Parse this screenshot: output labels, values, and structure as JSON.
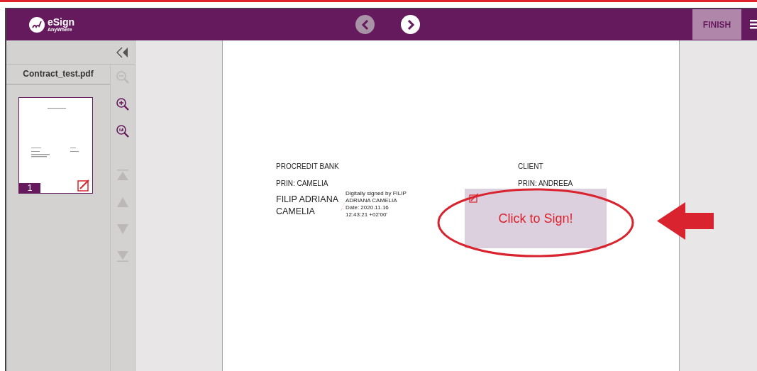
{
  "header": {
    "logo": {
      "name": "eSign",
      "tagline": "AnyWhere"
    },
    "nav": [
      {
        "kind": "previous",
        "disabled": true
      },
      {
        "kind": "next",
        "disabled": false
      }
    ],
    "finish": "FINISH"
  },
  "sidebar": {
    "file_name": "Contract_test.pdf",
    "thumbnails": [
      {
        "page": "1",
        "selected": true
      }
    ]
  },
  "tools": [
    {
      "kind": "zoom-out",
      "disabled": true
    },
    {
      "kind": "zoom-in",
      "disabled": false
    },
    {
      "kind": "zoom-reset",
      "disabled": false
    },
    {
      "kind": "first-page",
      "disabled": true
    },
    {
      "kind": "previous-page",
      "disabled": true
    },
    {
      "kind": "next-page",
      "disabled": true
    },
    {
      "kind": "last-page",
      "disabled": true
    }
  ],
  "document": {
    "parties": [
      {
        "name": "PROCREDIT BANK",
        "prin": "PRIN: CAMELIA",
        "signature": {
          "kind": "signed",
          "signer": "FILIP ADRIANA CAMELIA",
          "details": [
            "Digitally signed by FILIP",
            "ADRIANA CAMELIA",
            "Date: 2020.11.16",
            "12:43:21 +02'00'"
          ]
        }
      },
      {
        "name": "CLIENT",
        "prin": "PRIN: ANDREEA",
        "signature": {
          "kind": "field",
          "label": "Click to Sign!"
        }
      }
    ]
  }
}
